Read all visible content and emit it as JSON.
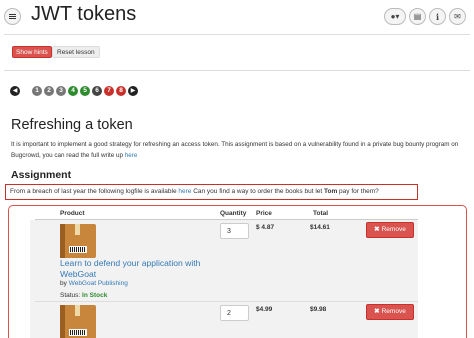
{
  "header": {
    "title": "JWT tokens",
    "icons": [
      "menu-icon",
      "user-icon",
      "image-icon",
      "info-icon",
      "envelope-icon"
    ]
  },
  "toolbar": {
    "show_hints": "Show hints",
    "reset_lesson": "Reset lesson"
  },
  "pagination": {
    "pages": [
      {
        "label": "1",
        "status": "gray"
      },
      {
        "label": "2",
        "status": "gray"
      },
      {
        "label": "3",
        "status": "gray"
      },
      {
        "label": "4",
        "status": "green"
      },
      {
        "label": "5",
        "status": "green"
      },
      {
        "label": "6",
        "status": "gray"
      },
      {
        "label": "7",
        "status": "red"
      },
      {
        "label": "8",
        "status": "red"
      }
    ]
  },
  "lesson": {
    "heading": "Refreshing a token",
    "intro": "It is important to implement a good strategy for refreshing an access token. This assignment is based on a vulnerability found in a private bug bounty program on Bugcrowd, you can read the full write up ",
    "intro_link": "here",
    "assignment_heading": "Assignment",
    "assignment_pre": "From a breach of last year the following logfile is available ",
    "assignment_link": "here",
    "assignment_mid": " Can you find a way to order the books but let ",
    "assignment_bold": "Tom",
    "assignment_post": " pay for them?"
  },
  "cart": {
    "columns": [
      "Product",
      "Quantity",
      "Price",
      "Total"
    ],
    "items": [
      {
        "title": "Learn to defend your application with WebGoat",
        "by_label": "by",
        "publisher": "WebGoat Publishing",
        "status_label": "Status:",
        "status": "In Stock",
        "quantity": "3",
        "price": "$ 4.87",
        "total": "$14.61",
        "remove": "Remove"
      },
      {
        "quantity": "2",
        "price": "$4.99",
        "total": "$9.98",
        "remove": "Remove"
      }
    ]
  },
  "colors": {
    "accent_red": "#d9534f",
    "link_blue": "#337ab7",
    "success_green": "#2e8b2e"
  }
}
